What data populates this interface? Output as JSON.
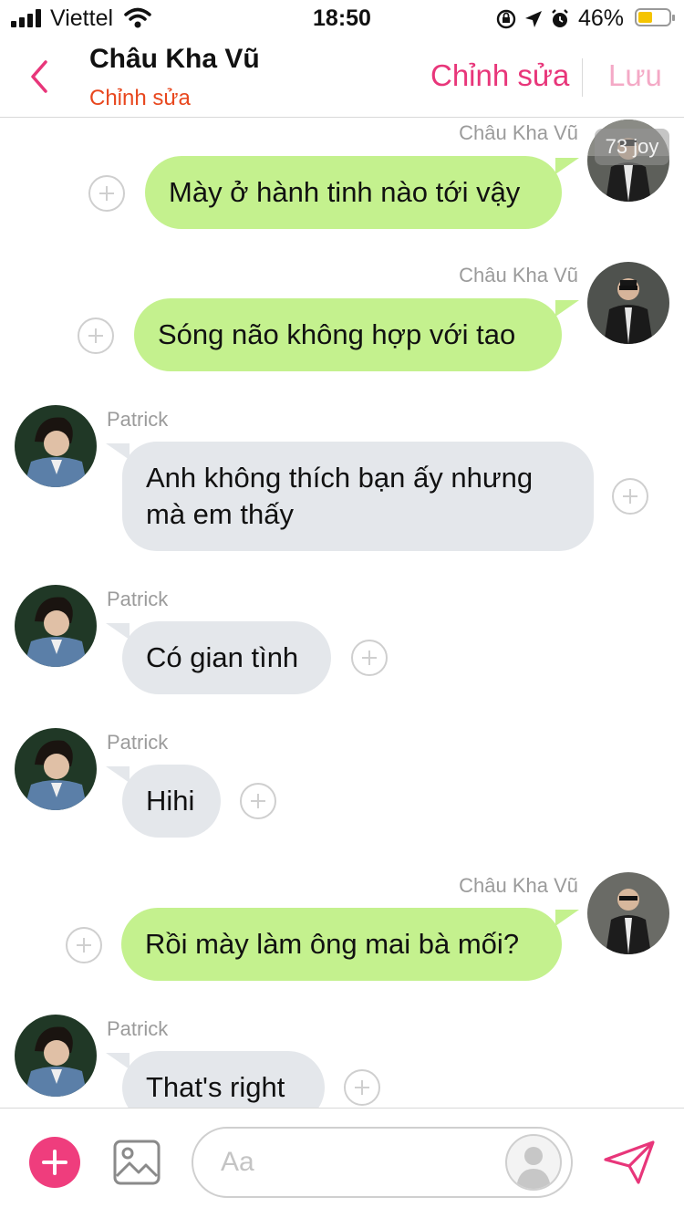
{
  "status_bar": {
    "carrier": "Viettel",
    "time": "18:50",
    "battery_percent": "46%",
    "battery_level": 0.46
  },
  "header": {
    "title": "Châu Kha Vũ",
    "subtitle": "Chỉnh sửa",
    "edit_label": "Chỉnh sửa",
    "save_label": "Lưu"
  },
  "messages": [
    {
      "sender": "Châu Kha Vũ",
      "side": "right",
      "text": "Mày ở hành tinh nào tới vậy",
      "watermark": "73 joy"
    },
    {
      "sender": "Châu Kha Vũ",
      "side": "right",
      "text": "Sóng não không hợp với tao"
    },
    {
      "sender": "Patrick",
      "side": "left",
      "text": "Anh không thích bạn ấy nhưng mà em thấy"
    },
    {
      "sender": "Patrick",
      "side": "left",
      "text": "Có gian tình"
    },
    {
      "sender": "Patrick",
      "side": "left",
      "text": "Hihi"
    },
    {
      "sender": "Châu Kha Vũ",
      "side": "right",
      "text": "Rồi mày làm ông mai bà mối?"
    },
    {
      "sender": "Patrick",
      "side": "left",
      "text": "That's right"
    }
  ],
  "composer": {
    "placeholder": "Aa"
  },
  "colors": {
    "accent": "#ef3d7d",
    "edit_pink": "#e8367a",
    "subtitle_orange": "#e8471e",
    "outgoing_bubble": "#c4f18e",
    "incoming_bubble": "#e4e7eb"
  },
  "icons": [
    "back-chevron-icon",
    "add-icon",
    "image-icon",
    "send-icon",
    "add-reaction-icon",
    "wifi-icon",
    "signal-icon",
    "battery-icon",
    "alarm-icon",
    "location-icon",
    "rotation-lock-icon"
  ]
}
